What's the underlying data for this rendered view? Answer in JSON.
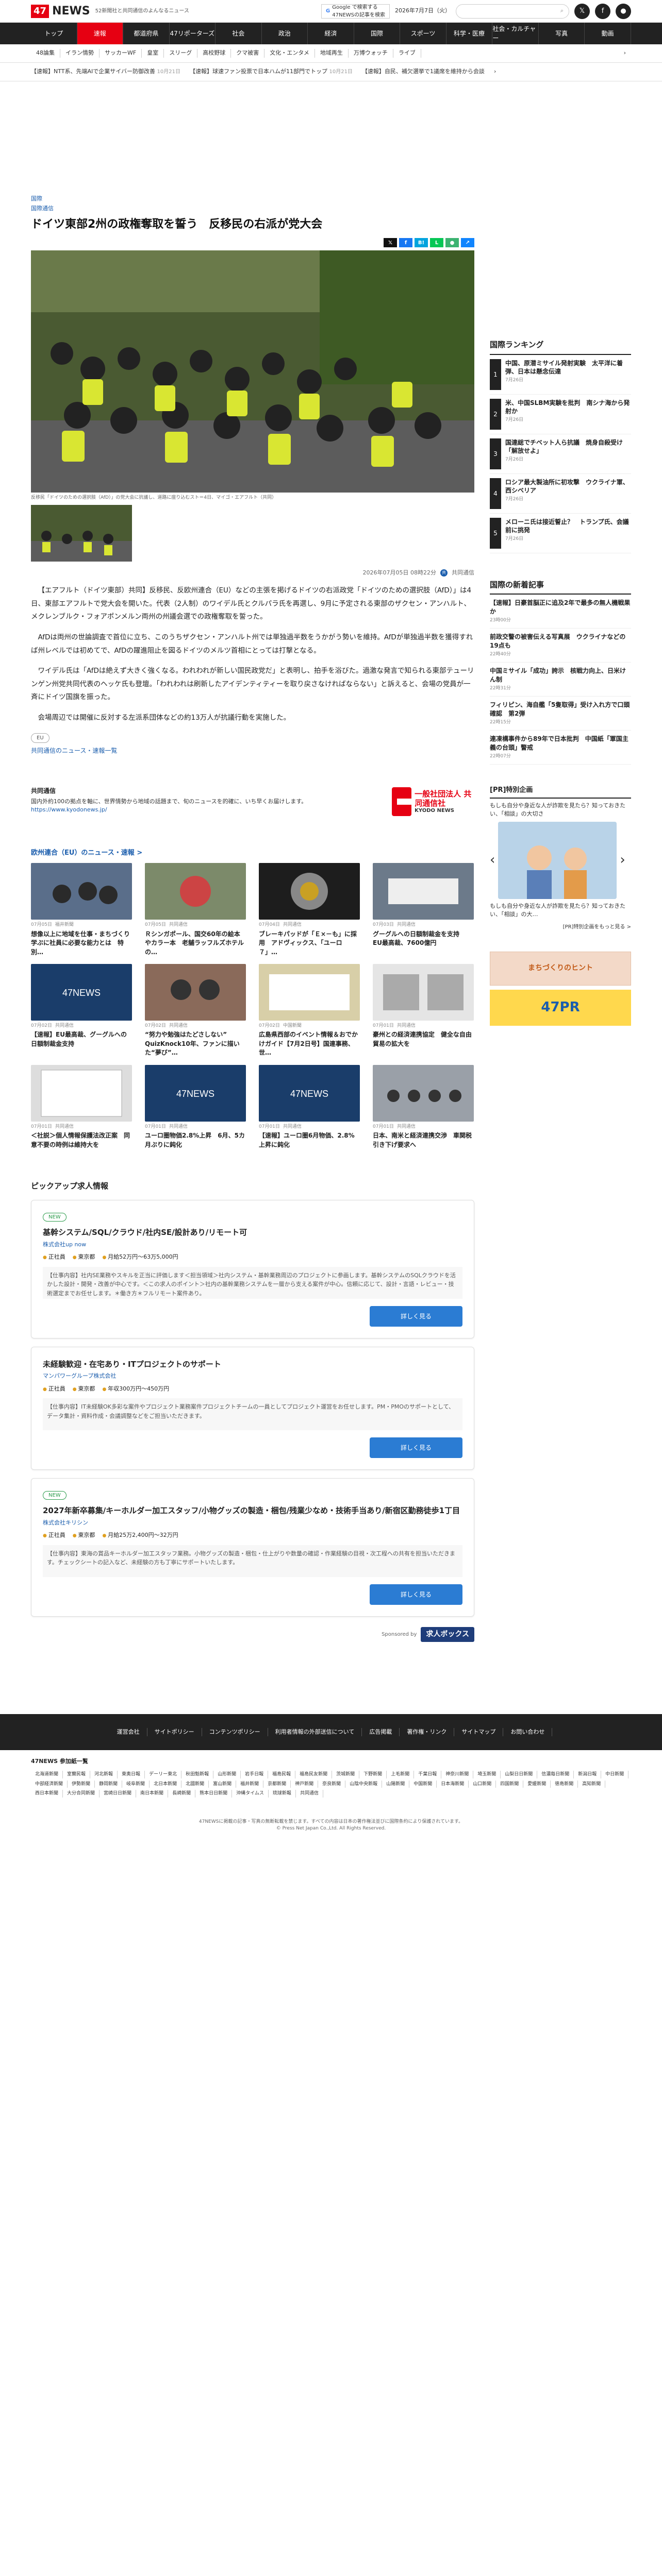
{
  "header": {
    "logo_num": "47",
    "logo_text": "NEWS",
    "tagline": "52新聞社と共同通信のよんなるニュース",
    "google_label": "Google で検索する",
    "google_sub": "47NEWSの記事を検索",
    "date": "2026年7月7日（火）",
    "search_placeholder": "",
    "social": [
      "𝕏",
      "f",
      "●"
    ]
  },
  "nav": [
    "トップ",
    "速報",
    "都道府県",
    "47リポーターズ",
    "社会",
    "政治",
    "経済",
    "国際",
    "スポーツ",
    "科学・医療",
    "社会・カルチャー",
    "写真",
    "動画"
  ],
  "subnav": [
    "48論集",
    "イラン情勢",
    "サッカーWF",
    "皇室",
    "スリーグ",
    "高校野球",
    "クマ被害",
    "文化・エンタメ",
    "地域再生",
    "万博ウォッチ",
    "ライブ"
  ],
  "ticker": [
    {
      "text": "【速報】NTT系、先端AIで企業サイバー防御改善",
      "date": "10月21日"
    },
    {
      "text": "【速報】球速ファン投票で日本ハムが11部門でトップ",
      "date": "10月21日"
    },
    {
      "text": "【速報】自民、補欠選挙で1議席を維持から会談",
      "date": "10月21日"
    }
  ],
  "article": {
    "breadcrumb": "国際",
    "category": "国際通信",
    "title": "ドイツ東部2州の政権奪取を誓う　反移民の右派が党大会",
    "share": [
      "𝕏",
      "f",
      "B!",
      "L",
      "●",
      "↗"
    ],
    "caption": "反移民「ドイツのための選択肢（AfD）」の党大会に抗議し、道路に座り込むスト＝4日、マイゴ・エアフルト（共同）",
    "datetime": "2026年07月05日 08時22分",
    "provider": "共同通信",
    "paragraphs": [
      "【エアフルト（ドイツ東部）共同】反移民、反欧州連合（EU）などの主張を掲げるドイツの右派政党「ドイツのための選択肢（AfD）」は4日、東部エアフルトで党大会を開いた。代表（2人制）のワイデル氏とクルパラ氏を再選し、9月に予定される東部のザクセン・アンハルト、メクレンブルク・フォアポンメルン両州の州議会選での政権奪取を誓った。",
      "AfDは両州の世論調査で首位に立ち、このうちザクセン・アンハルト州では単独過半数をうかがう勢いを維持。AfDが単独過半数を獲得すれば州レベルでは初めてで、AfDの躍進阻止を図るドイツのメルツ首相にとっては打撃となる。",
      "ワイデル氏は「AfDは絶えず大きく強くなる。われわれが新しい国民政党だ」と表明し、拍手を浴びた。過激な発言で知られる東部テューリンゲン州党共同代表のヘッケ氏も登壇。「われわれは刷新したアイデンティティーを取り戻さなければならない」と訴えると、会場の党員が一斉にドイツ国旗を振った。",
      "会場周辺では開催に反対する左派系団体などの約13万人が抗議行動を実施した。"
    ],
    "tag": "EU",
    "news_link": "共同通信のニュース・速報一覧"
  },
  "provider_box": {
    "title": "共同通信",
    "desc": "国内外約100の拠点を軸に、世界情勢から地域の話題まで、旬のニュースを的確に、いち早くお届けします。",
    "url": "https://www.kyodonews.jp/",
    "logo_main": "一般社団法人 共同通信社",
    "logo_sub": "KYODO NEWS"
  },
  "related": {
    "heading": "欧州連合（EU）のニュース・速報 >",
    "items": [
      {
        "date": "07月05日",
        "src": "福井新聞",
        "title": "想像以上に地域を仕事・まちづくり学ぶに社員に必要な能力とは　特別…"
      },
      {
        "date": "07月05日",
        "src": "共同通信",
        "title": "Ｒシンガポール、国交60年の絵本やカラー本　老舗ラッフルズホテルの…"
      },
      {
        "date": "07月04日",
        "src": "共同通信",
        "title": "ブレーキパッドが「Ｅ×－も」に採用　アドヴィックス、「ユーロ７」…"
      },
      {
        "date": "07月03日",
        "src": "共同通信",
        "title": "グーグルへの日額制裁金を支持　EU最高裁、7600億円"
      },
      {
        "date": "07月02日",
        "src": "共同通信",
        "title": "【速報】EU最高裁、グーグルへの日額制裁金支持"
      },
      {
        "date": "07月02日",
        "src": "共同通信",
        "title": "“努力や勉強はたどさしない” QuizKnock10年、ファンに描いた“夢び”…"
      },
      {
        "date": "07月02日",
        "src": "中国新聞",
        "title": "広島県西部のイベント情報＆おでかけガイド【7月2日号】国連事務、世…"
      },
      {
        "date": "07月01日",
        "src": "共同通信",
        "title": "豪州との経済連携協定　健全な自由貿易の拡大を"
      },
      {
        "date": "07月01日",
        "src": "共同通信",
        "title": "＜社説＞個人情報保護法改正案　同意不要の時例は維持大を"
      },
      {
        "date": "07月01日",
        "src": "共同通信",
        "title": "ユーロ圏物価2.8%上昇　6月、5カ月ぶりに鈍化"
      },
      {
        "date": "07月01日",
        "src": "共同通信",
        "title": "【速報】ユーロ圏6月物価、2.8%上昇に鈍化"
      },
      {
        "date": "07月01日",
        "src": "共同通信",
        "title": "日本、南米と経済連携交渉　車関税引き下げ要求へ"
      }
    ]
  },
  "jobs": {
    "heading": "ピックアップ求人情報",
    "items": [
      {
        "new": "NEW",
        "title": "基幹システム/SQL/クラウド/社内SE/設計あり/リモート可",
        "company": "株式会社up now",
        "type": "正社員",
        "place": "東京都",
        "pay": "月給52万円〜63万5,000円",
        "desc": "【仕事内容】社内SE業務やスキルを正当に評価します＜担当領域＞社内システム・基幹業務周辺のプロジェクトに参画します。基幹システムのSQLクラウドを活かした設計・開発・改善が中心です。＜この求人のポイント＞社内の基幹業務システムを一層から支える案件が中心。信頼に応じて、設計・言語・レビュー・技術選定までお任せします。＊働き方＊フルリモート案件あり。",
        "more": "詳しく見る"
      },
      {
        "new": "",
        "title": "未経験歓迎・在宅あり・ITプロジェクトのサポート",
        "company": "マンパワーグループ株式会社",
        "type": "正社員",
        "place": "東京都",
        "pay": "年収300万円〜450万円",
        "desc": "【仕事内容】IT未経験OK多彩な案件やプロジェクト業務案件プロジェクトチームの一員としてプロジェクト運営をお任せします。PM・PMOのサポートとして、データ集計・資料作成・会議調整などをご担当いただきます。",
        "more": "詳しく見る"
      },
      {
        "new": "NEW",
        "title": "2027年新卒募集/キーホルダー加工スタッフ/小物グッズの製造・梱包/残業少なめ・技術手当あり/新宿区勤務徒歩1丁目",
        "company": "株式会社キリシン",
        "type": "正社員",
        "place": "東京都",
        "pay": "月給25万2,400円〜32万円",
        "desc": "【仕事内容】東海の賞品キーホルダー加工スタッフ業務。小物グッズの製造・梱包・仕上がりや数量の確認・作業経験の目視・次工程への共有を担当いただきます。チェックシートの記入など、未経験の方も丁寧にサポートいたします。",
        "more": "詳しく見る"
      }
    ],
    "sponsored": "Sponsored by",
    "sponsor_name": "求人ボックス"
  },
  "sidebar": {
    "ranking_heading": "国際ランキング",
    "ranking": [
      {
        "num": "1",
        "title": "中国、原潜ミサイル発射実験　太平洋に着弾、日本は懸念伝達",
        "date": "7月26日"
      },
      {
        "num": "2",
        "title": "米、中国SLBM実験を批判　南シナ海から発射か",
        "date": "7月26日"
      },
      {
        "num": "3",
        "title": "国連総でチベット人ら抗議　焼身自殺受け「解放せよ」",
        "date": "7月26日"
      },
      {
        "num": "4",
        "title": "ロシア最大製油所に初攻撃　ウクライナ軍、西シベリア",
        "date": "7月26日"
      },
      {
        "num": "5",
        "title": "メローニ氏は接近誓止？　トランプ氏、会議前に挑発",
        "date": "7月26日"
      }
    ],
    "latest_heading": "国際の新着記事",
    "latest": [
      {
        "title": "【速報】日豪首脳正に追及2年で最多の無人機戦果か",
        "date": "23時00分"
      },
      {
        "title": "前政交警の被害伝える写真展　ウクライナなどの19点も",
        "date": "22時40分"
      },
      {
        "title": "中国ミサイル「成功」誇示　核戦力向上、日米けん制",
        "date": "22時31分"
      },
      {
        "title": "フィリピン、海自艦「5隻取得」受け入れ方で口頭確認　第2弾",
        "date": "22時15分"
      },
      {
        "title": "連凍構事件から89年で日本批判　中国紙「軍国主義の台頭」警戒",
        "date": "22時07分"
      }
    ],
    "pr_heading": "[PR]特別企画",
    "pr_text": "もしも自分や身近な人が詐欺を見たら？知っておきたい、「相談」の大切さ",
    "pr_caption": "もしも自分や身近な人が詐欺を見たら？知っておきたい、「相談」の大…",
    "pr_link": "[PR]特別企画をもっと見る >",
    "banner1": "まちづくりのヒント",
    "banner2": "47PR"
  },
  "footer": {
    "links": [
      "運営会社",
      "サイトポリシー",
      "コンテンツポリシー",
      "利用者情報の外部送信について",
      "広告掲載",
      "著作権・リンク",
      "サイトマップ",
      "お問い合わせ"
    ],
    "partners_heading": "47NEWS 参加紙一覧",
    "partners": [
      "北海道新聞",
      "室蘭民報",
      "河北新報",
      "東奥日報",
      "デーリー東北",
      "秋田魁新報",
      "山形新聞",
      "岩手日報",
      "福島民報",
      "福島民友新聞",
      "茨城新聞",
      "下野新聞",
      "上毛新聞",
      "千葉日報",
      "神奈川新聞",
      "埼玉新聞",
      "山梨日日新聞",
      "信濃毎日新聞",
      "新潟日報",
      "中日新聞",
      "中部経済新聞",
      "伊勢新聞",
      "静岡新聞",
      "岐阜新聞",
      "北日本新聞",
      "北國新聞",
      "富山新聞",
      "福井新聞",
      "京都新聞",
      "神戸新聞",
      "奈良新聞",
      "山陰中央新報",
      "山陽新聞",
      "中国新聞",
      "日本海新聞",
      "山口新聞",
      "四国新聞",
      "愛媛新聞",
      "徳島新聞",
      "高知新聞",
      "西日本新聞",
      "大分合同新聞",
      "宮崎日日新聞",
      "南日本新聞",
      "長崎新聞",
      "熊本日日新聞",
      "沖縄タイムス",
      "琉球新報",
      "共同通信"
    ],
    "copyright": "47NEWSに掲載の記事・写真の無断転載を禁じます。すべての内容は日本の著作権法並びに国際条約により保護されています。",
    "copyright2": "© Press Net Japan Co.,Ltd. All Rights Reserved."
  },
  "colors": {
    "accent": "#e60012",
    "link": "#1a5dad"
  }
}
